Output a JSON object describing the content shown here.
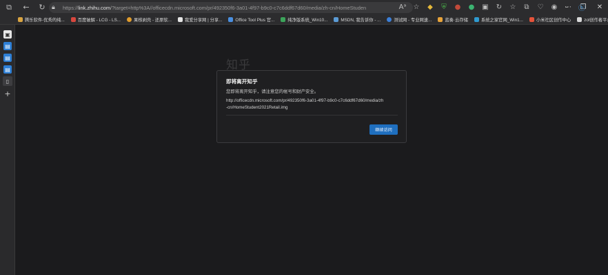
{
  "browser": {
    "url_prefix": "https://",
    "url_host": "link.zhihu.com",
    "url_rest": "/?target=http%3A//officecdn.microsoft.com/pr/492350f6-3a01-4f97-b9c0-c7c6ddf67d60/media/zh-cn/HomeStudent2021Retail.img",
    "bookmarks": [
      {
        "label": "腾乐软件-优秀的纯...",
        "color": "#d9a441"
      },
      {
        "label": "百度破解 - LCG - LS...",
        "color": "#d7473e"
      },
      {
        "label": "果核剥壳 - 还原软...",
        "color": "#e09c2c"
      },
      {
        "label": "我爱分享网 | 分享...",
        "color": "#e5e5e5"
      },
      {
        "label": "Office Tool Plus 官...",
        "color": "#4a8fe0"
      },
      {
        "label": "纯净版系统_Win10...",
        "color": "#3ca45a"
      },
      {
        "label": "MSDN, 我告诉你 - ...",
        "color": "#5b9bd5"
      },
      {
        "label": "测试网 - 专业网速...",
        "color": "#3c7fd8"
      },
      {
        "label": "蓝奏·云存储",
        "color": "#e8a33a"
      },
      {
        "label": "系统之家官网_Win1...",
        "color": "#2f9ad0"
      },
      {
        "label": "小米社区创作中心",
        "color": "#e5533a"
      },
      {
        "label": "zol创作者平台",
        "color": "#d8d8d8"
      }
    ]
  },
  "page": {
    "logo_text": "知乎",
    "dialog": {
      "title": "即将离开知乎",
      "message": "您即将离开知乎，请注意您的帐号和财产安全。",
      "url": "http://officecdn.microsoft.com/pr/492350f6-3a01-4f97-b9c0-c7c6ddf67d60/media/zh-cn/HomeStudent2021Retail.img",
      "continue_label": "继续访问"
    }
  }
}
